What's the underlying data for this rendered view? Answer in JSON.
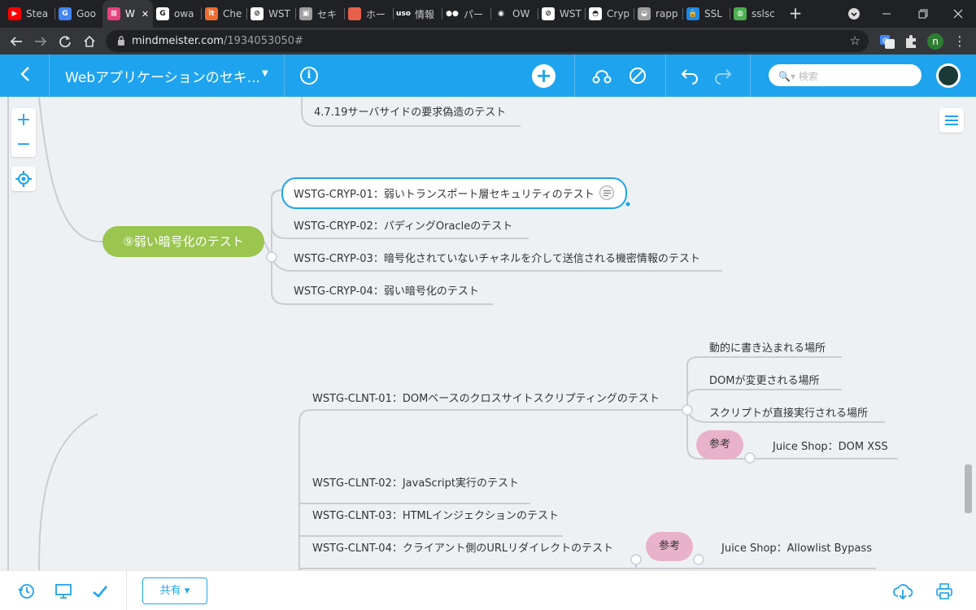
{
  "browser": {
    "tabs": [
      {
        "label": "Stea",
        "color": "#ff0000",
        "glyph": "▶"
      },
      {
        "label": "Goo",
        "color": "#4285f4",
        "glyph": "G"
      },
      {
        "label": "W",
        "color": "#e8417a",
        "glyph": "⊠",
        "active": true
      },
      {
        "label": "owa",
        "color": "#ffffff",
        "glyph": "G"
      },
      {
        "label": "Che",
        "color": "#ef6c2f",
        "glyph": "ît"
      },
      {
        "label": "WST",
        "color": "#ffffff",
        "glyph": "⊘"
      },
      {
        "label": "セキ",
        "color": "#9e9e9e",
        "glyph": "▣"
      },
      {
        "label": "ホー",
        "color": "#e8604c",
        "glyph": ""
      },
      {
        "label": "情報",
        "color": "#202124",
        "glyph": "uso"
      },
      {
        "label": "パー",
        "color": "#202124",
        "glyph": "●●"
      },
      {
        "label": "OW",
        "color": "#202124",
        "glyph": "◉"
      },
      {
        "label": "WST",
        "color": "#ffffff",
        "glyph": "⊘"
      },
      {
        "label": "Cryp",
        "color": "#ffffff",
        "glyph": "◓"
      },
      {
        "label": "rapp",
        "color": "#9e9e9e",
        "glyph": "◒"
      },
      {
        "label": "SSL",
        "color": "#1e88e5",
        "glyph": "🔒"
      },
      {
        "label": "sslsc",
        "color": "#4caf50",
        "glyph": "◍"
      }
    ],
    "close_glyph": "✕",
    "new_tab_glyph": "+",
    "url_host": "mindmeister.com",
    "url_path": "/1934053050#",
    "profile_initial": "n"
  },
  "header": {
    "map_title": "Webアプリケーションのセキ...",
    "info_glyph": "i",
    "add_glyph": "+",
    "search_placeholder": "🔍▾ 検索",
    "back_glyph": "‹"
  },
  "canvas": {
    "zoom_in": "+",
    "zoom_out": "−",
    "top_node": "4.7.19サーバサイドの要求偽造のテスト",
    "main_node": "⑨弱い暗号化のテスト",
    "cryp_nodes": [
      "WSTG-CRYP-01：弱いトランスポート層セキュリティのテスト",
      "WSTG-CRYP-02：パディングOracleのテスト",
      "WSTG-CRYP-03：暗号化されていないチャネルを介して送信される機密情報のテスト",
      "WSTG-CRYP-04：弱い暗号化のテスト"
    ],
    "clnt_nodes": [
      "WSTG-CLNT-01：DOMベースのクロスサイトスクリプティングのテスト",
      "WSTG-CLNT-02：JavaScript実行のテスト",
      "WSTG-CLNT-03：HTMLインジェクションのテスト",
      "WSTG-CLNT-04：クライアント側のURLリダイレクトのテスト"
    ],
    "clnt01_children": [
      "動的に書き込まれる場所",
      "DOMが変更される場所",
      "スクリプトが直接実行される場所"
    ],
    "ref_label": "参考",
    "ref_label_2": "参考",
    "ref_link_1": "Juice Shop：DOM XSS",
    "ref_link_2": "Juice Shop：Allowlist Bypass"
  },
  "footer": {
    "share_label": "共有 ▾"
  },
  "colors": {
    "accent": "#1ea3ee",
    "main_node": "#9ac54f",
    "ref_node": "#e8b2ca"
  }
}
